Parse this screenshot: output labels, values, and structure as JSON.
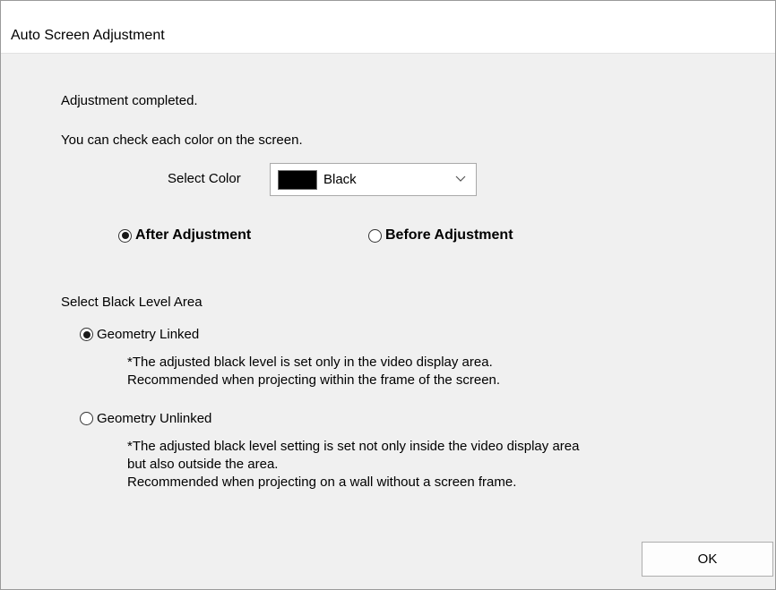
{
  "window": {
    "title": "Auto Screen Adjustment"
  },
  "messages": {
    "completed": "Adjustment completed.",
    "check": "You can check each color on the screen."
  },
  "color_select": {
    "label": "Select Color",
    "selected": "Black",
    "swatch_color": "#000000",
    "options_visible": [
      "Black"
    ]
  },
  "view_mode": {
    "after": {
      "label": "After Adjustment",
      "checked": true
    },
    "before": {
      "label": "Before Adjustment",
      "checked": false
    }
  },
  "black_level": {
    "heading": "Select Black Level Area",
    "linked": {
      "label": "Geometry Linked",
      "checked": true,
      "note_line1": "*The adjusted black level is set only in the video display area.",
      "note_line2": "Recommended when projecting within the frame of the screen."
    },
    "unlinked": {
      "label": "Geometry Unlinked",
      "checked": false,
      "note_line1": "*The adjusted black level setting is set not only inside the video display area",
      "note_line2": "but also outside the area.",
      "note_line3": "Recommended when projecting on a wall without a screen frame."
    }
  },
  "buttons": {
    "ok": "OK"
  }
}
